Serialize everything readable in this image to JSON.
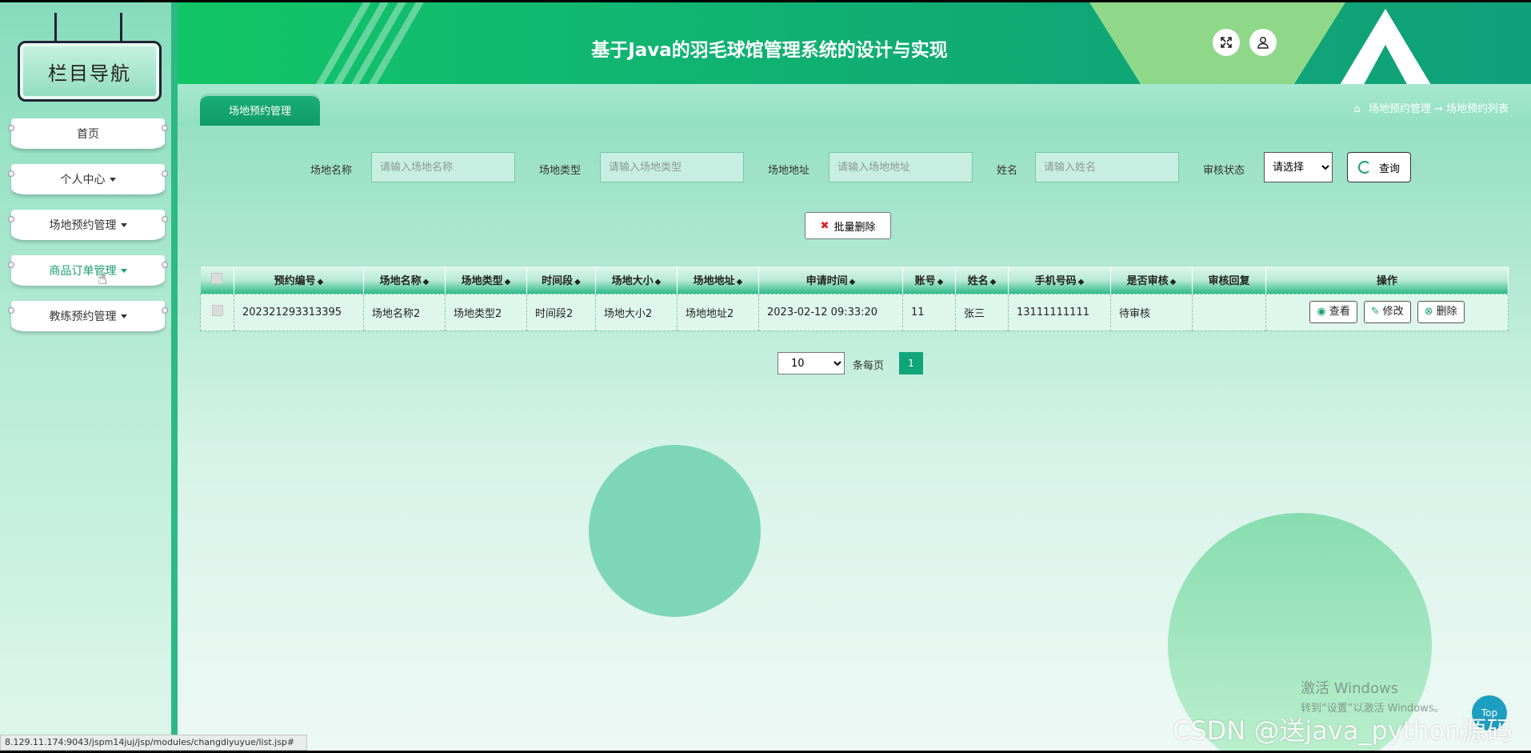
{
  "header": {
    "title": "基于Java的羽毛球馆管理系统的设计与实现",
    "fullscreen_icon": "expand-icon",
    "user_icon": "user-icon"
  },
  "sidebar": {
    "title": "栏目导航",
    "items": [
      {
        "label": "首页",
        "dropdown": false
      },
      {
        "label": "个人中心",
        "dropdown": true
      },
      {
        "label": "场地预约管理",
        "dropdown": true
      },
      {
        "label": "商品订单管理",
        "dropdown": true
      },
      {
        "label": "教练预约管理",
        "dropdown": true
      }
    ]
  },
  "tabbar": {
    "active_tab": "场地预约管理",
    "breadcrumb": "场地预约管理 → 场地预约列表"
  },
  "search": {
    "venue_name_label": "场地名称",
    "venue_name_placeholder": "请输入场地名称",
    "venue_type_label": "场地类型",
    "venue_type_placeholder": "请输入场地类型",
    "venue_address_label": "场地地址",
    "venue_address_placeholder": "请输入场地地址",
    "name_label": "姓名",
    "name_placeholder": "请输入姓名",
    "status_label": "审核状态",
    "status_selected": "请选择",
    "query_button": "查询"
  },
  "actions": {
    "batch_delete": "批量删除"
  },
  "table": {
    "headers": [
      "预约编号",
      "场地名称",
      "场地类型",
      "时间段",
      "场地大小",
      "场地地址",
      "申请时间",
      "账号",
      "姓名",
      "手机号码",
      "是否审核",
      "审核回复",
      "操作"
    ],
    "rows": [
      {
        "booking_no": "202321293313395",
        "venue_name": "场地名称2",
        "venue_type": "场地类型2",
        "time_slot": "时间段2",
        "venue_size": "场地大小2",
        "venue_address": "场地地址2",
        "apply_time": "2023-02-12 09:33:20",
        "account": "11",
        "name": "张三",
        "phone": "13111111111",
        "audit_status": "待审核",
        "audit_reply": ""
      }
    ],
    "op_view": "查看",
    "op_edit": "修改",
    "op_delete": "删除"
  },
  "pagination": {
    "page_size": "10",
    "per_page_label": "条每页",
    "current_page": "1"
  },
  "statusbar": {
    "url": "8.129.11.174:9043/jspm14juj/jsp/modules/changdiyuyue/list.jsp#"
  },
  "overlay": {
    "activate_title": "激活 Windows",
    "activate_sub": "转到“设置”以激活 Windows。",
    "watermark": "CSDN @送java_python源码",
    "top_button": "Top"
  },
  "colors": {
    "brand_green": "#11a57a",
    "header_green": "#11c565",
    "accent": "#1aa06e"
  }
}
